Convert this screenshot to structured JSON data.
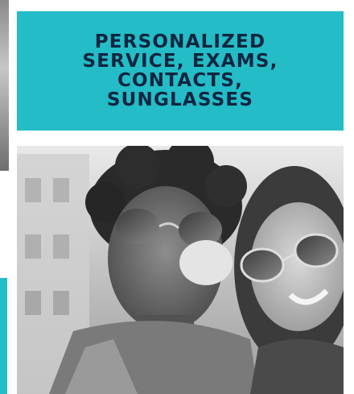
{
  "banner": {
    "title": "PERSONALIZED\nSERVICE, EXAMS,\nCONTACTS,\nSUNGLASSES",
    "background_color": "#23bcc7",
    "text_color": "#10253f"
  },
  "photo": {
    "style": "black-and-white",
    "subject_icon": "people-photo"
  },
  "side_strips": {
    "bottom_accent_color": "#23bcc7"
  }
}
